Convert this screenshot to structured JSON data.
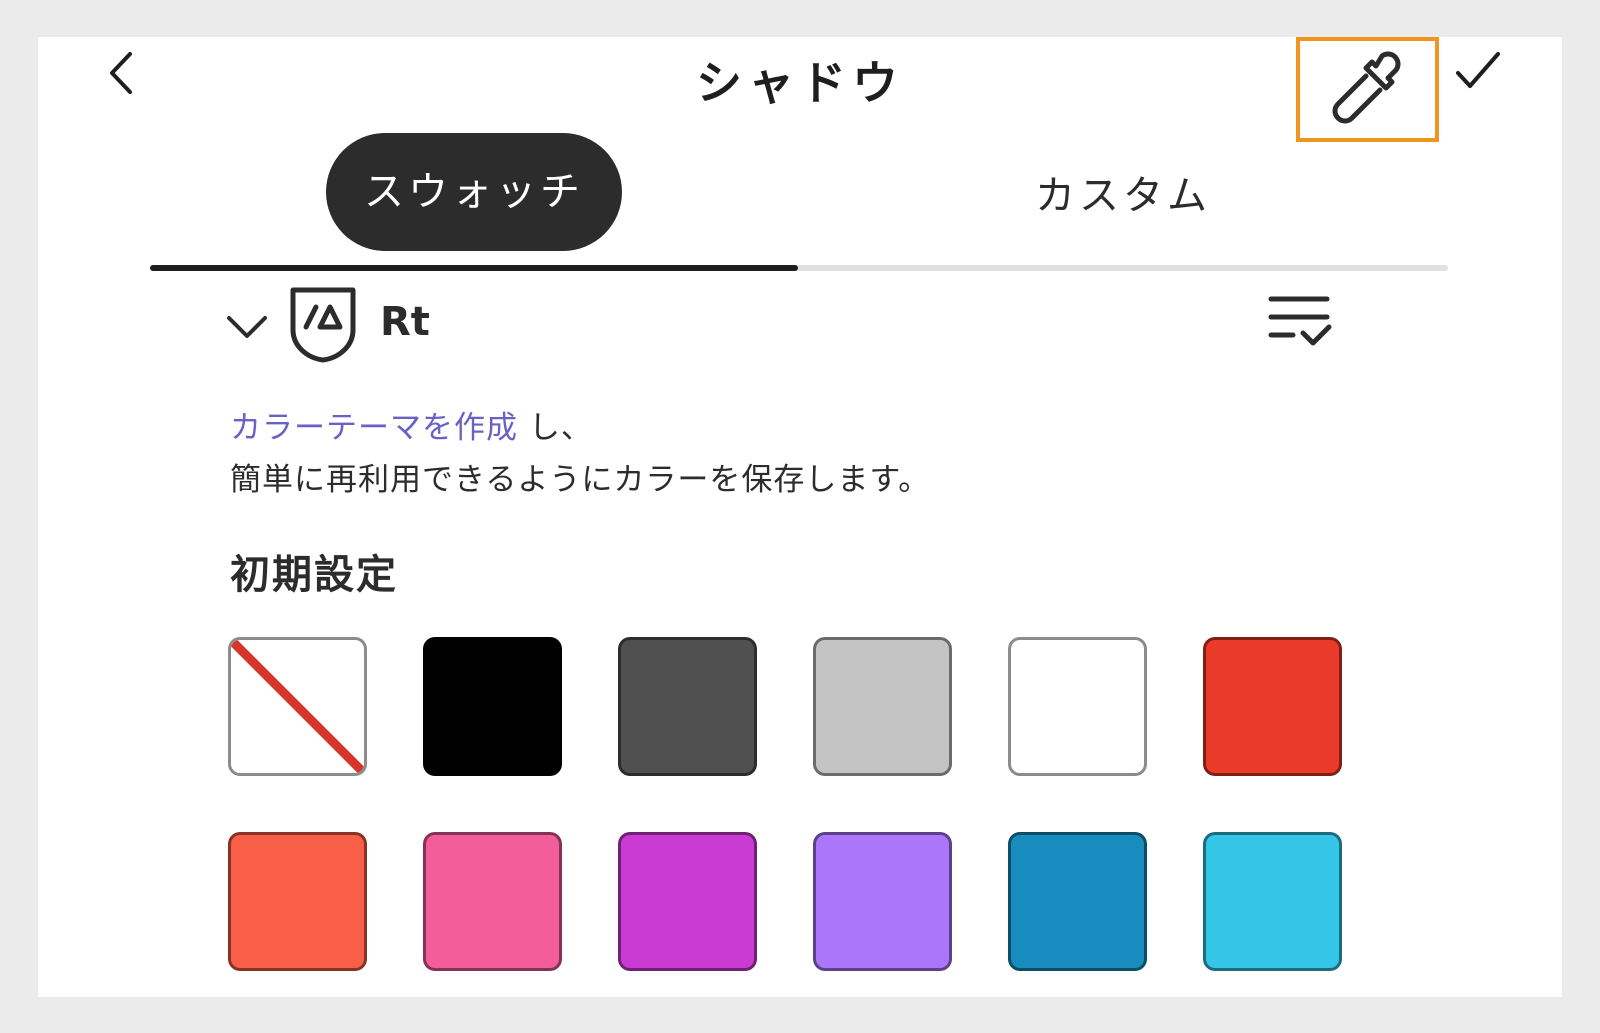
{
  "header": {
    "title": "シャドウ"
  },
  "tabs": [
    {
      "label": "スウォッチ",
      "selected": true
    },
    {
      "label": "カスタム",
      "selected": false
    }
  ],
  "library": {
    "name": "Rt"
  },
  "info": {
    "link_text": "カラーテーマを作成",
    "after_link": " し、",
    "line2": "簡単に再利用できるようにカラーを保存します。"
  },
  "section": {
    "title": "初期設定"
  },
  "swatches": [
    {
      "color": "none"
    },
    {
      "color": "#000000"
    },
    {
      "color": "#505050"
    },
    {
      "color": "#c3c3c3"
    },
    {
      "color": "#ffffff"
    },
    {
      "color": "#ea3a29"
    },
    {
      "color": "#f95e48"
    },
    {
      "color": "#f25d9a"
    },
    {
      "color": "#c93bd2"
    },
    {
      "color": "#ac76fa"
    },
    {
      "color": "#188cbe"
    },
    {
      "color": "#34c5e7"
    }
  ],
  "colors": {
    "accent_highlight": "#f0961e",
    "link": "#6a61c4",
    "tab_selected_bg": "#2c2c2c"
  }
}
